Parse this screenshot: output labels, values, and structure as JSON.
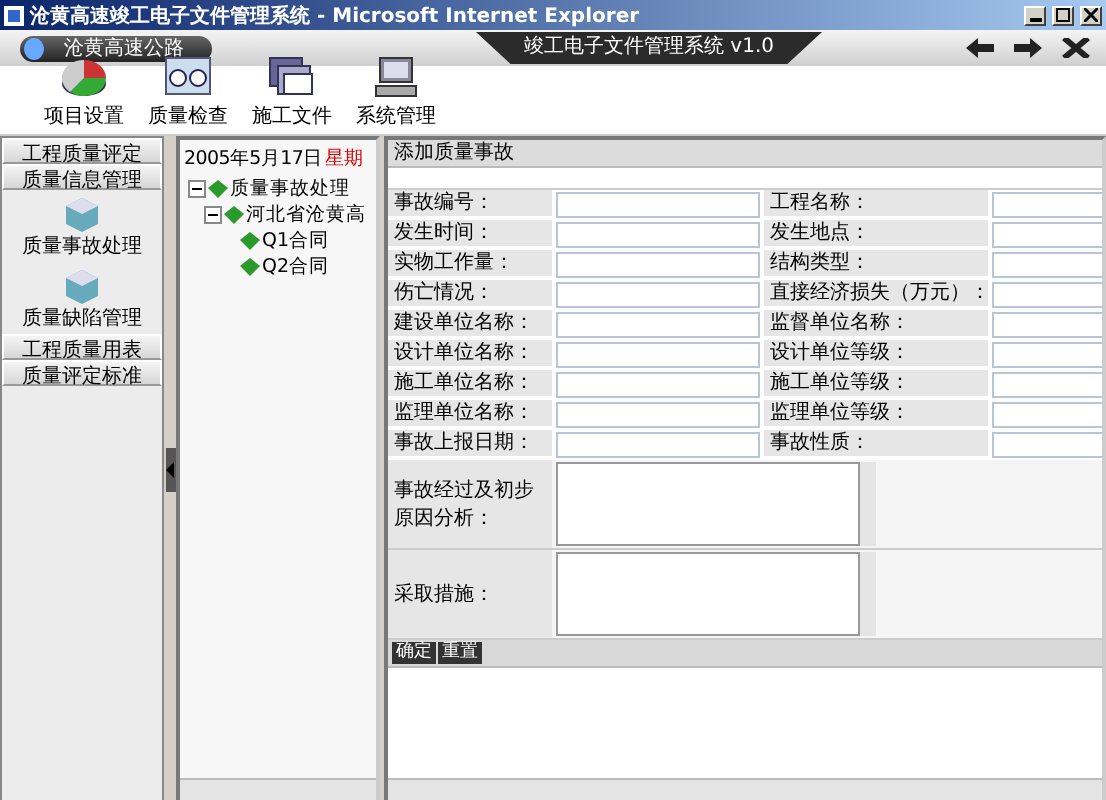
{
  "window": {
    "title": "沧黄高速竣工电子文件管理系统 - Microsoft Internet Explorer"
  },
  "header": {
    "site": "沧黄高速公路",
    "app_title": "竣工电子文件管理系统 v1.0"
  },
  "toolbar": [
    {
      "label": "项目设置"
    },
    {
      "label": "质量检查"
    },
    {
      "label": "施工文件"
    },
    {
      "label": "系统管理"
    }
  ],
  "nav": [
    {
      "kind": "header",
      "label": "工程质量评定"
    },
    {
      "kind": "header",
      "label": "质量信息管理"
    },
    {
      "kind": "tool",
      "label": "质量事故处理"
    },
    {
      "kind": "tool",
      "label": "质量缺陷管理"
    },
    {
      "kind": "header",
      "label": "工程质量用表"
    },
    {
      "kind": "header",
      "label": "质量评定标准"
    }
  ],
  "tree": {
    "date": "2005年5月17日",
    "weekday": "星期",
    "items": [
      {
        "label": "质量事故处理",
        "expanded": true,
        "children": [
          {
            "label": "河北省沧黄高",
            "expanded": true,
            "children": [
              {
                "label": "Q1合同"
              },
              {
                "label": "Q2合同"
              }
            ]
          }
        ]
      }
    ]
  },
  "form": {
    "title": "添加质量事故",
    "fields": [
      "事故编号：",
      "工程名称：",
      "发生时间：",
      "发生地点：",
      "实物工作量：",
      "结构类型：",
      "伤亡情况：",
      "直接经济损失（万元）：",
      "建设单位名称：",
      "监督单位名称：",
      "设计单位名称：",
      "设计单位等级：",
      "施工单位名称：",
      "施工单位等级：",
      "监理单位名称：",
      "监理单位等级：",
      "事故上报日期：",
      "事故性质："
    ],
    "textareas": [
      "事故经过及初步原因分析：",
      "采取措施："
    ],
    "buttons": [
      "确定",
      "重置"
    ]
  }
}
